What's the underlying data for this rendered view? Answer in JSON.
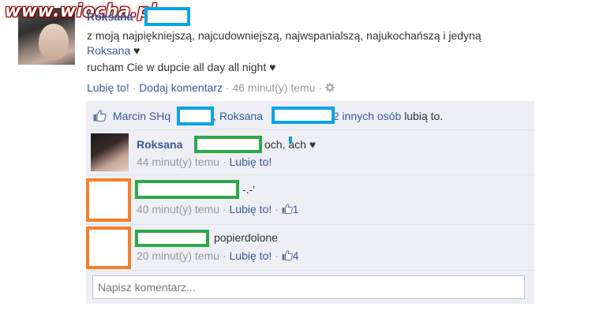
{
  "watermark": "www.wiocha.pl",
  "post": {
    "author": "Roksana",
    "text_line1": "z moją najpiękniejszą, najcudowniejszą, najwspanialszą, najukochańszą i jedyną",
    "tag_name": "Roksana",
    "heart": "♥",
    "text_line2": "rucham Cie w dupcie all day all night ♥",
    "actions": {
      "like": "Lubię to!",
      "separator": "·",
      "add_comment": "Dodaj komentarz",
      "time": "46 minut(y) temu"
    }
  },
  "likes": {
    "person1": "Marcin SHq",
    "comma": ",",
    "person2": "Roksana",
    "others": "i 2 innych osób",
    "suffix": "lubią to."
  },
  "comments": [
    {
      "author": "Roksana",
      "text": "och, ach ♥",
      "time": "44 minut(y) temu",
      "like": "Lubię to!",
      "likes": ""
    },
    {
      "author": "",
      "text": "-.-'",
      "time": "40 minut(y) temu",
      "like": "Lubię to!",
      "likes": "1"
    },
    {
      "author": "",
      "text": "popierdolone",
      "time": "20 minut(y) temu",
      "like": "Lubię to!",
      "likes": "4"
    }
  ],
  "comment_box": {
    "placeholder": "Napisz komentarz..."
  },
  "icons": [
    "gear-icon",
    "thumbs-up-icon"
  ],
  "colors": {
    "link": "#3b5998",
    "ufi_bg": "#edeff4",
    "redact_blue": "#0aa3e8",
    "redact_green": "#2ea84a",
    "redact_orange": "#f2802d"
  }
}
